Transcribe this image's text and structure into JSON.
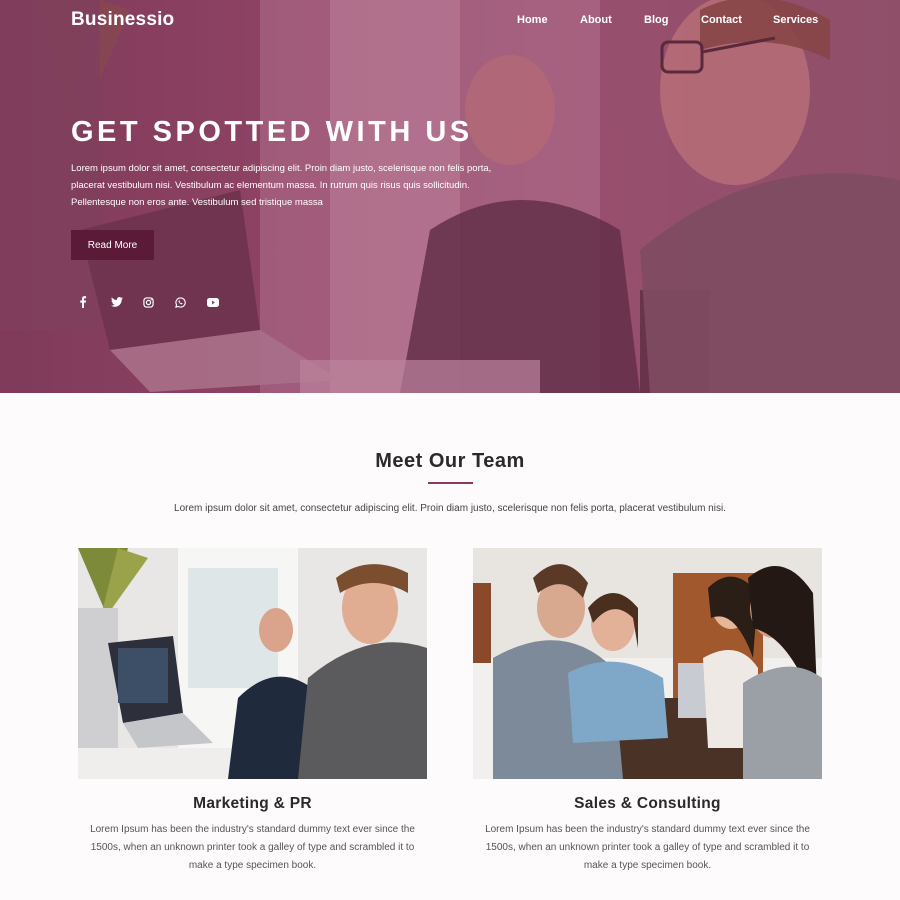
{
  "brand": {
    "logo": "Businessio",
    "accent": "#8b3a5e",
    "button_bg": "#5a1a38"
  },
  "nav": {
    "items": [
      {
        "label": "Home"
      },
      {
        "label": "About"
      },
      {
        "label": "Blog"
      },
      {
        "label": "Contact"
      },
      {
        "label": "Services"
      }
    ]
  },
  "hero": {
    "title": "GET SPOTTED WITH US",
    "text": "Lorem ipsum dolor sit amet, consectetur adipiscing elit. Proin diam justo, scelerisque non felis porta, placerat vestibulum nisi. Vestibulum ac elementum massa. In rutrum quis risus quis sollicitudin. Pellentesque non eros ante. Vestibulum sed tristique massa",
    "button_label": "Read More",
    "socials": [
      "facebook-icon",
      "twitter-icon",
      "instagram-icon",
      "whatsapp-icon",
      "youtube-icon"
    ]
  },
  "team": {
    "title": "Meet Our Team",
    "subtitle": "Lorem ipsum dolor sit amet, consectetur adipiscing elit. Proin diam justo, scelerisque non felis porta, placerat vestibulum nisi.",
    "cards": [
      {
        "title": "Marketing & PR",
        "text": "Lorem Ipsum has been the industry's standard dummy text ever since the 1500s, when an unknown printer took a galley of type and scrambled it to make a type specimen book."
      },
      {
        "title": "Sales & Consulting",
        "text": "Lorem Ipsum has been the industry's standard dummy text ever since the 1500s, when an unknown printer took a galley of type and scrambled it to make a type specimen book."
      }
    ]
  }
}
